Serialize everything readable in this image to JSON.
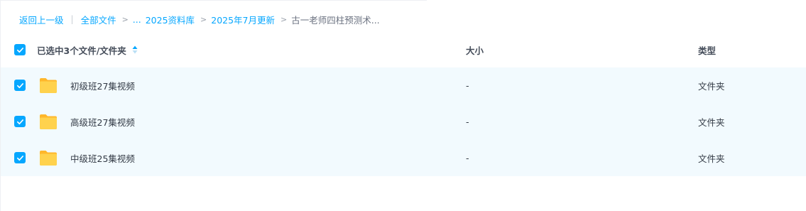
{
  "breadcrumb": {
    "back_label": "返回上一级",
    "pipe": "|",
    "items": [
      "全部文件",
      "2025资料库",
      "2025年7月更新"
    ],
    "ellipsis": "...",
    "separator": ">",
    "current": "古一老师四柱预测术..."
  },
  "header": {
    "selection_label": "已选中3个文件/文件夹",
    "size_label": "大小",
    "type_label": "类型"
  },
  "files": [
    {
      "name": "初级班27集视频",
      "size": "-",
      "type": "文件夹",
      "checked": true
    },
    {
      "name": "高级班27集视频",
      "size": "-",
      "type": "文件夹",
      "checked": true
    },
    {
      "name": "中级班25集视频",
      "size": "-",
      "type": "文件夹",
      "checked": true
    }
  ],
  "colors": {
    "accent": "#06a7ff",
    "row_selected_bg": "#f2fafe",
    "folder": "#ffc83d"
  }
}
